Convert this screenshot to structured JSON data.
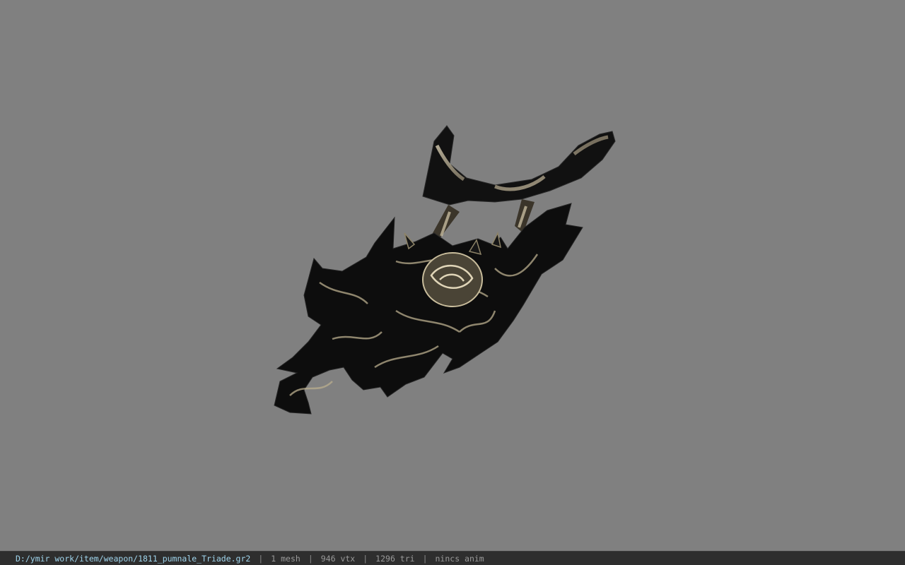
{
  "viewer": {
    "background_color": "#808080",
    "model_icon": "dagger-model-icon"
  },
  "statusbar": {
    "file_path": "D:/ymir work/item/weapon/1811_pumnale_Triade.gr2",
    "separator": "|",
    "mesh_count": "1 mesh",
    "vertex_count": "946 vtx",
    "triangle_count": "1296 tri",
    "animation": "nincs anim",
    "path_color": "#9fd4ec",
    "text_color": "#9a9a9a"
  }
}
